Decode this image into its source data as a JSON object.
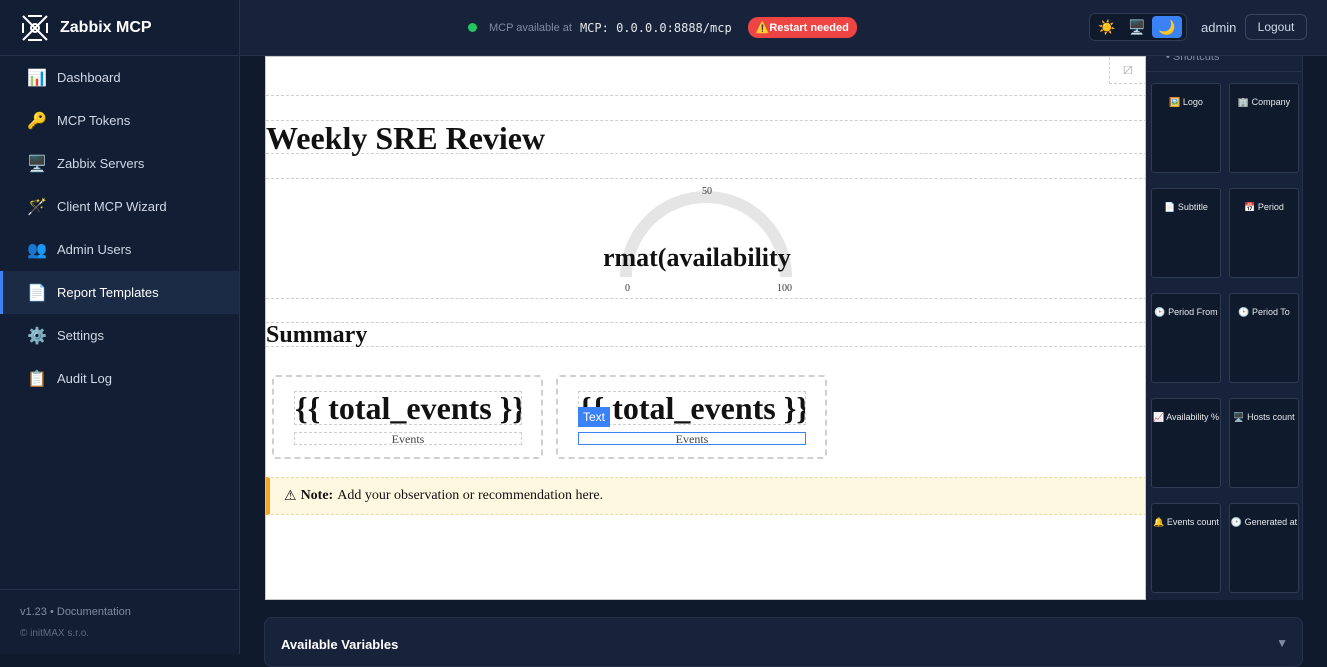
{
  "brand": {
    "name": "Zabbix MCP"
  },
  "nav": [
    {
      "icon": "📊",
      "icon_name": "bar-chart-icon",
      "label": "Dashboard"
    },
    {
      "icon": "🔑",
      "icon_name": "key-icon",
      "label": "MCP Tokens"
    },
    {
      "icon": "🖥️",
      "icon_name": "monitor-icon",
      "label": "Zabbix Servers"
    },
    {
      "icon": "🪄",
      "icon_name": "magic-wand-icon",
      "label": "Client MCP Wizard"
    },
    {
      "icon": "👥",
      "icon_name": "users-icon",
      "label": "Admin Users"
    },
    {
      "icon": "📄",
      "icon_name": "document-icon",
      "label": "Report Templates",
      "active": true
    },
    {
      "icon": "⚙️",
      "icon_name": "gear-icon",
      "label": "Settings"
    },
    {
      "icon": "📋",
      "icon_name": "clipboard-icon",
      "label": "Audit Log"
    }
  ],
  "footer": {
    "version": "v1.23 • Documentation",
    "copyright": "© initMAX s.r.o."
  },
  "topbar": {
    "mcp_label": "MCP available at",
    "mcp_url": "MCP: 0.0.0.0:8888/mcp",
    "restart": "⚠️Restart needed",
    "theme_light": "☀️",
    "theme_system": "🖥️",
    "theme_dark": "🌙",
    "user": "admin",
    "logout": "Logout"
  },
  "canvas": {
    "title": "Weekly SRE Review",
    "gauge": {
      "text": "format(availability",
      "min": "0",
      "mid": "50",
      "max": "100"
    },
    "summary": "Summary",
    "cards": [
      {
        "value": "{{ total_events }}",
        "label": "Events"
      },
      {
        "value": "{{ total_events }}",
        "label": "Events",
        "selected": true
      }
    ],
    "text_tag": "Text",
    "note": {
      "icon": "⚠",
      "bold": "Note:",
      "text": "Add your observation or recommendation here."
    }
  },
  "shortcuts": {
    "header": "• Shortcuts",
    "tiles": [
      {
        "icon": "🖼️",
        "label": "Logo"
      },
      {
        "icon": "🏢",
        "label": "Company"
      },
      {
        "icon": "📄",
        "label": "Subtitle"
      },
      {
        "icon": "📅",
        "label": "Period"
      },
      {
        "icon": "🕒",
        "label": "Period From"
      },
      {
        "icon": "🕒",
        "label": "Period To"
      },
      {
        "icon": "📈",
        "label": "Availability %"
      },
      {
        "icon": "🖥️",
        "label": "Hosts count"
      },
      {
        "icon": "🔔",
        "label": "Events count"
      },
      {
        "icon": "🕒",
        "label": "Generated at"
      }
    ]
  },
  "variables": {
    "title": "Available Variables",
    "chevron": "▼"
  },
  "colors": {
    "accent": "#3b82f6",
    "status_ok": "#22c55e",
    "danger": "#ef4444",
    "note_border": "#f5a623"
  }
}
